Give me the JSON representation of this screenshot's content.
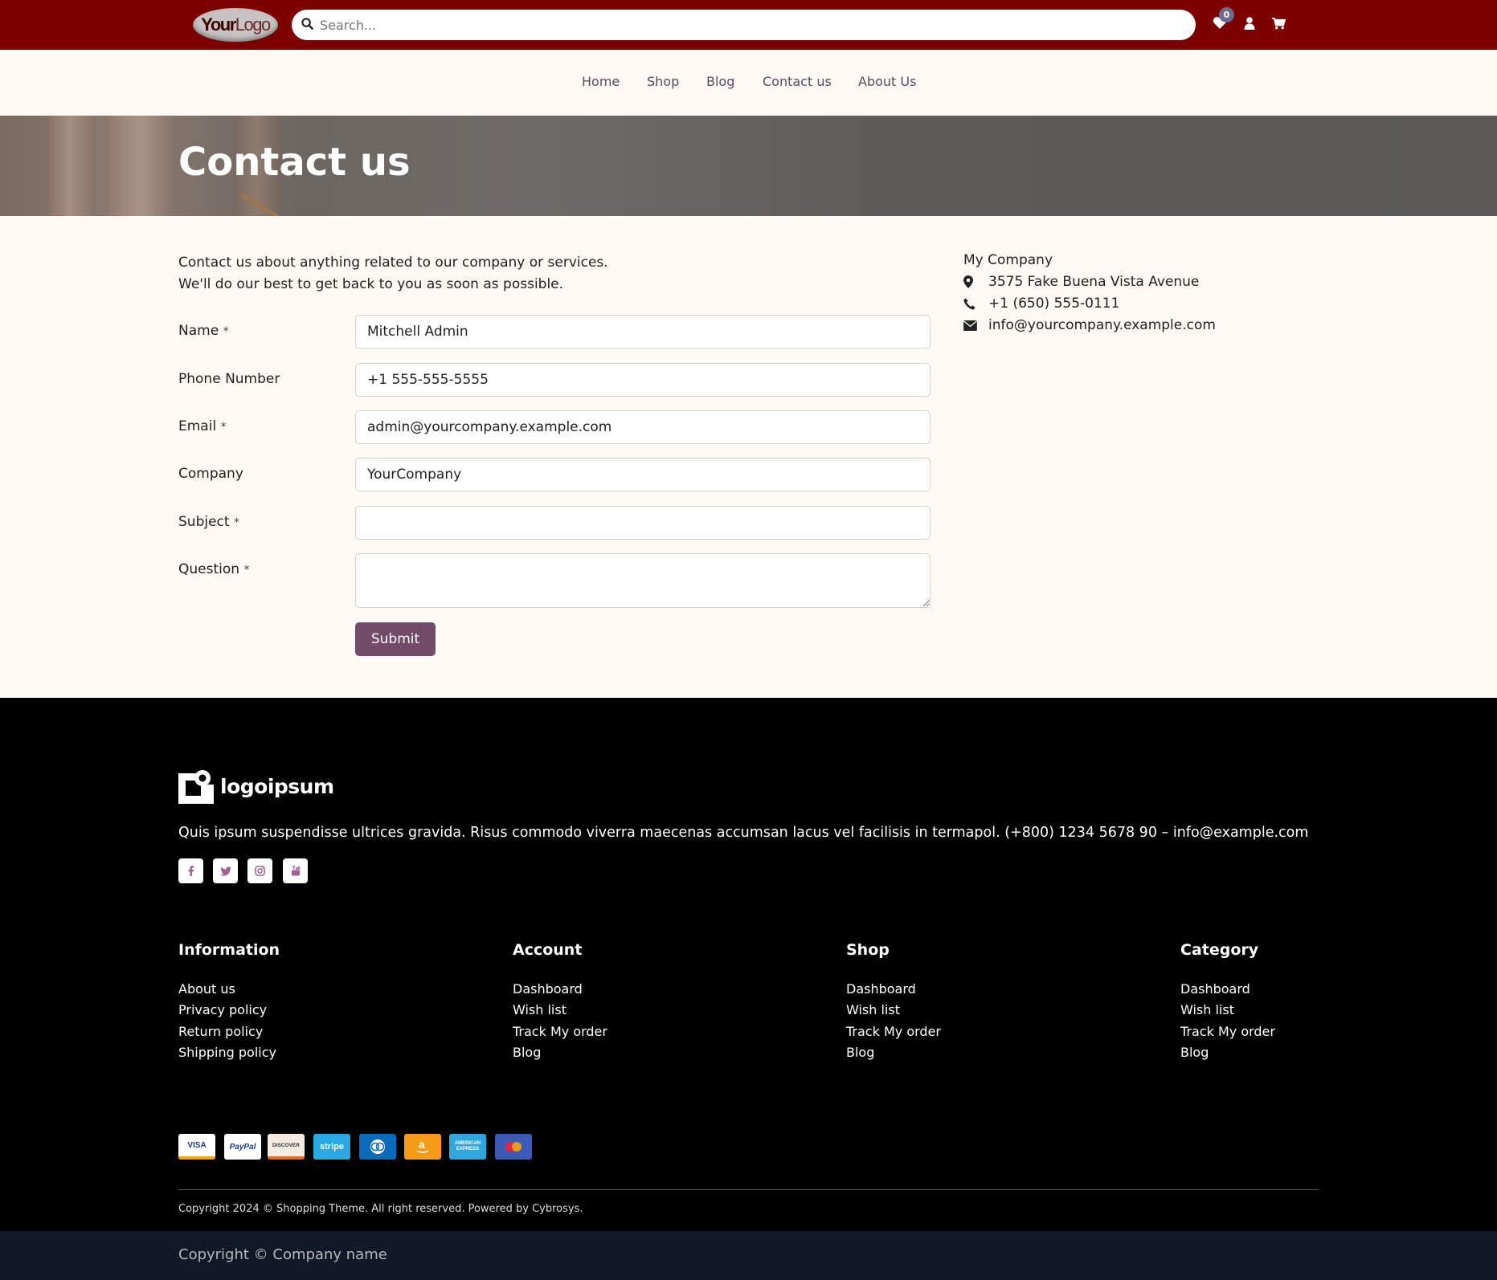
{
  "header": {
    "logo_text_bold": "Your",
    "logo_text_rest": "Logo",
    "search_placeholder": "Search...",
    "wishlist_count": "0",
    "icons": [
      "search-icon",
      "heart-icon",
      "user-icon",
      "cart-icon"
    ],
    "bar_color": "#7d0000"
  },
  "nav": {
    "items": [
      "Home",
      "Shop",
      "Blog",
      "Contact us",
      "About Us"
    ]
  },
  "hero": {
    "title": "Contact us"
  },
  "main": {
    "intro_line1": "Contact us about anything related to our company or services.",
    "intro_line2": "We'll do our best to get back to you as soon as possible.",
    "form": {
      "name_label": "Name",
      "name_value": "Mitchell Admin",
      "phone_label": "Phone Number",
      "phone_value": "+1 555-555-5555",
      "email_label": "Email",
      "email_value": "admin@yourcompany.example.com",
      "company_label": "Company",
      "company_value": "YourCompany",
      "subject_label": "Subject",
      "subject_value": "",
      "question_label": "Question",
      "question_value": "",
      "required_mark": "*",
      "submit_label": "Submit",
      "submit_color": "#714b67"
    },
    "company_info": {
      "name": "My Company",
      "address": "3575 Fake Buena Vista Avenue",
      "phone": "+1 (650) 555-0111",
      "email": "info@yourcompany.example.com",
      "icons": [
        "map-marker-icon",
        "phone-icon",
        "envelope-icon"
      ]
    }
  },
  "footer": {
    "logo_text": "logoipsum",
    "description": "Quis ipsum suspendisse ultrices gravida. Risus commodo viverra maecenas accumsan lacus vel facilisis in termapol. (+800) 1234 5678 90 – info@example.com",
    "social_icons": [
      "facebook-icon",
      "twitter-icon",
      "instagram-icon",
      "youtube-icon"
    ],
    "columns": [
      {
        "title": "Information",
        "links": [
          "About us",
          "Privacy policy",
          "Return policy",
          "Shipping policy"
        ]
      },
      {
        "title": "Account",
        "links": [
          "Dashboard",
          "Wish list",
          "Track My order",
          "Blog"
        ]
      },
      {
        "title": "Shop",
        "links": [
          "Dashboard",
          "Wish list",
          "Track My order",
          "Blog"
        ]
      },
      {
        "title": "Category",
        "links": [
          "Dashboard",
          "Wish list",
          "Track My order",
          "Blog"
        ]
      }
    ],
    "payments": [
      "VISA",
      "PayPal",
      "DISCOVER",
      "stripe",
      "diners-club-icon",
      "amazon-icon",
      "AMERICAN EXPRESS",
      "mastercard-icon"
    ],
    "copyright": "Copyright 2024 © Shopping Theme. All right reserved. Powered by Cybrosys.",
    "bottom_copyright": "Copyright © Company name"
  }
}
